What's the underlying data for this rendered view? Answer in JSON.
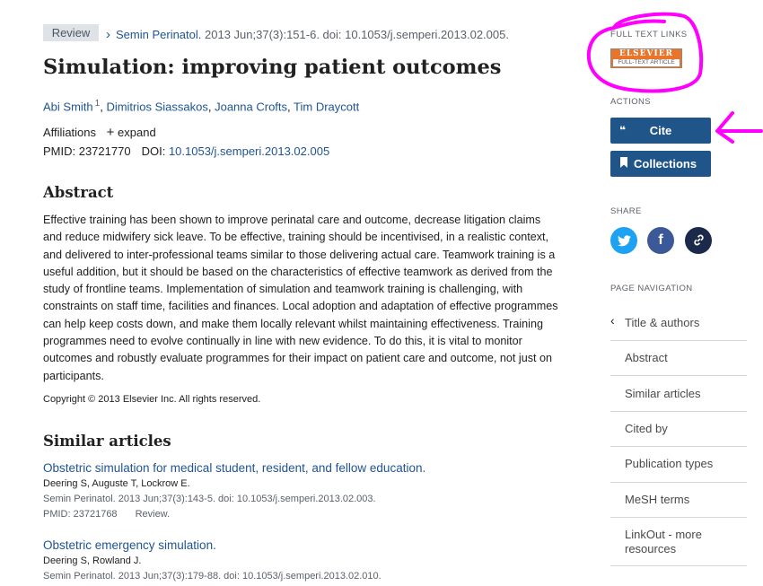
{
  "article": {
    "type_badge": "Review",
    "journal": "Semin Perinatol.",
    "citation": " 2013 Jun;37(3):151-6. doi: 10.1053/j.semperi.2013.02.005.",
    "title": "Simulation: improving patient outcomes",
    "authors": [
      {
        "name": "Abi Smith",
        "sup": "1"
      },
      {
        "name": "Dimitrios Siassakos"
      },
      {
        "name": "Joanna Crofts"
      },
      {
        "name": "Tim Draycott"
      }
    ],
    "affiliations_label": "Affiliations",
    "expand_label": "expand",
    "pmid_label": "PMID: 23721770",
    "doi_label": "DOI:",
    "doi": "10.1053/j.semperi.2013.02.005",
    "abstract_heading": "Abstract",
    "abstract": "Effective training has been shown to improve perinatal care and outcome, decrease litigation claims and reduce midwifery sick leave. To be effective, training should be incentivised, in a realistic context, and delivered to inter-professional teams similar to those delivering actual care. Teamwork training is a useful addition, but it should be based on the characteristics of effective teamwork as derived from the study of frontline teams. Implementation of simulation and teamwork training is challenging, with constraints on staff time, facilities and finances. Local adoption and adaptation of effective programmes can help keep costs down, and make them locally relevant whilst maintaining effectiveness. Training programmes need to evolve continually in line with new evidence. To do this, it is vital to monitor outcomes and robustly evaluate programmes for their impact on patient care and outcome, not just on participants.",
    "copyright": "Copyright © 2013 Elsevier Inc. All rights reserved."
  },
  "similar": {
    "heading": "Similar articles",
    "items": [
      {
        "title": "Obstetric simulation for medical student, resident, and fellow education.",
        "authors": "Deering S, Auguste T, Lockrow E.",
        "journal": "Semin Perinatol. 2013 Jun;37(3):143-5. doi: 10.1053/j.semperi.2013.02.003.",
        "pmid": "PMID: 23721768",
        "tag": "Review."
      },
      {
        "title": "Obstetric emergency simulation.",
        "authors": "Deering S, Rowland J.",
        "journal": "Semin Perinatol. 2013 Jun;37(3):179-88. doi: 10.1053/j.semperi.2013.02.010."
      }
    ]
  },
  "sidebar": {
    "full_text_label": "FULL TEXT LINKS",
    "elsevier_top": "ELSEVIER",
    "elsevier_bottom": "FULL-TEXT ARTICLE",
    "actions_label": "ACTIONS",
    "cite_label": "Cite",
    "collections_label": "Collections",
    "share_label": "SHARE",
    "page_nav_label": "PAGE NAVIGATION",
    "nav": [
      "Title & authors",
      "Abstract",
      "Similar articles",
      "Cited by",
      "Publication types",
      "MeSH terms",
      "LinkOut - more resources"
    ]
  },
  "colors": {
    "link": "#205493",
    "button": "#20558a",
    "annotation": "#ff00ff",
    "twitter": "#1da1f2",
    "facebook": "#3b5998",
    "permalink": "#1b2a4a"
  }
}
